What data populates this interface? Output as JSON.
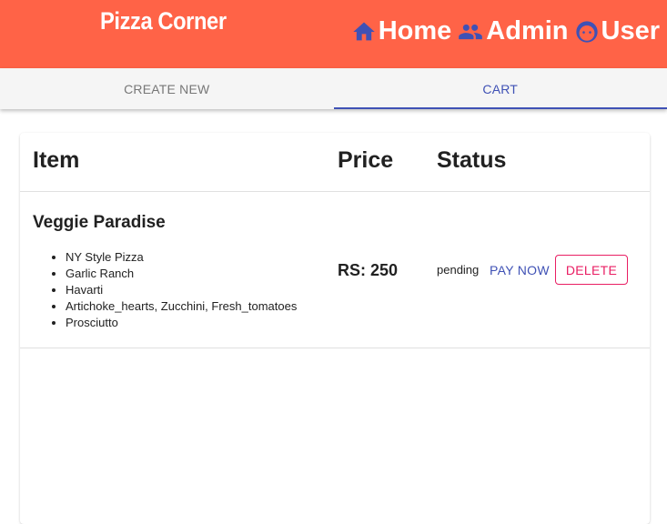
{
  "appbar": {
    "brand": "Pizza Corner",
    "nav": [
      {
        "label": "Home",
        "icon": "home-icon"
      },
      {
        "label": "Admin",
        "icon": "people-icon"
      },
      {
        "label": "User",
        "icon": "face-icon"
      }
    ],
    "background": "#ff6347",
    "icon_color": "#3f51b5"
  },
  "tabs": [
    {
      "label": "CREATE NEW",
      "active": false
    },
    {
      "label": "CART",
      "active": true
    }
  ],
  "table": {
    "headers": [
      "Item",
      "Price",
      "Status"
    ],
    "rows": [
      {
        "name": "Veggie Paradise",
        "toppings": [
          "NY Style Pizza",
          "Garlic Ranch",
          "Havarti",
          "Artichoke_hearts, Zucchini, Fresh_tomatoes",
          "Prosciutto"
        ],
        "price": "RS: 250",
        "status": "pending",
        "pay_label": "PAY NOW",
        "delete_label": "DELETE"
      }
    ]
  },
  "colors": {
    "primary": "#3f51b5",
    "secondary": "#e91e63"
  }
}
